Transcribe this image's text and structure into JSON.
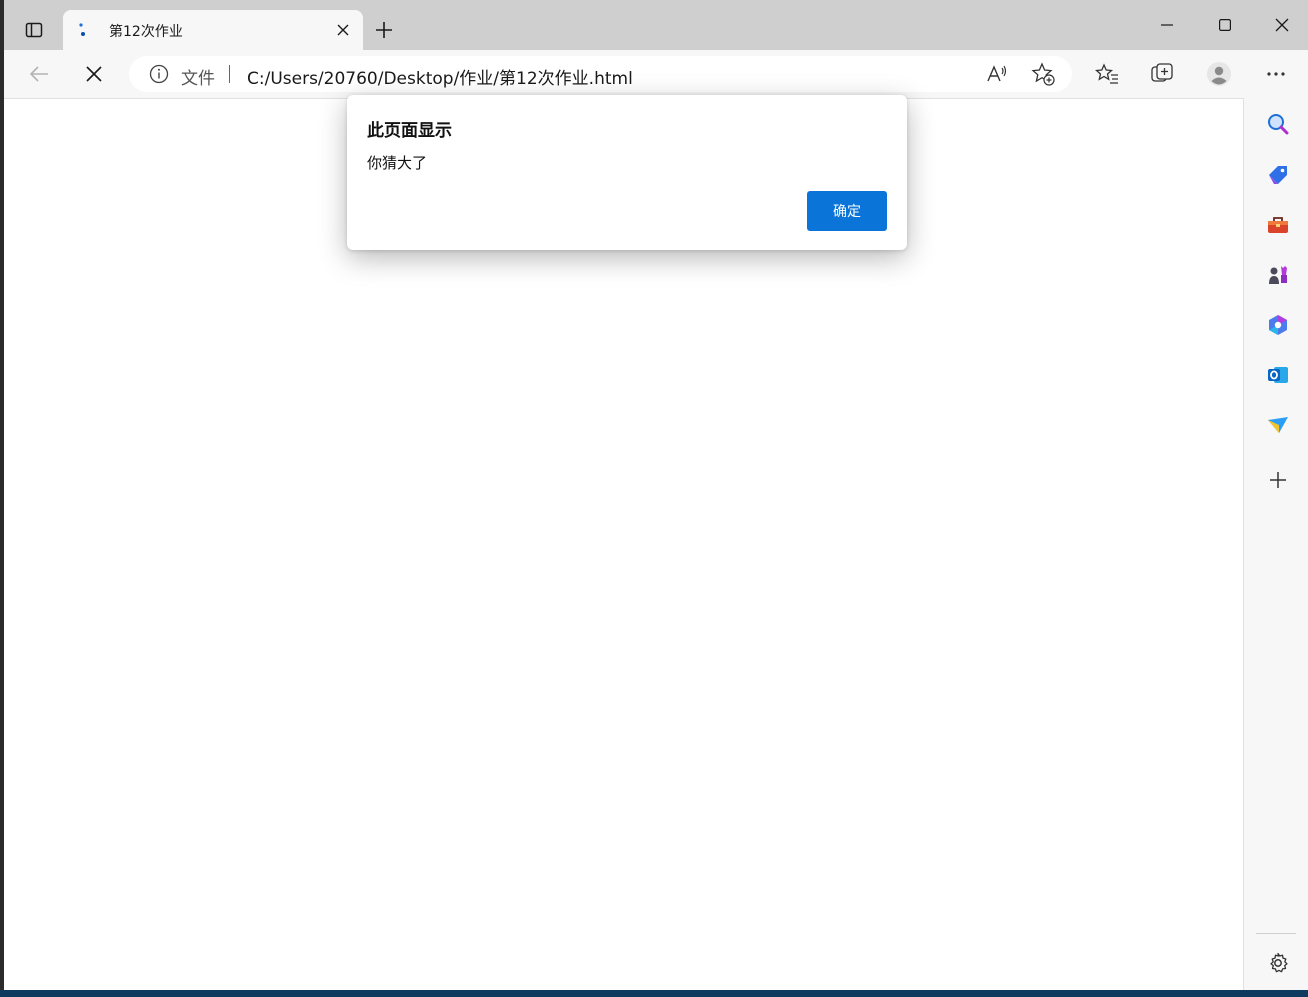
{
  "browser": {
    "tab": {
      "title": "第12次作业"
    },
    "address": {
      "label": "文件",
      "url": "C:/Users/20760/Desktop/作业/第12次作业.html"
    }
  },
  "dialog": {
    "title": "此页面显示",
    "message": "你猜大了",
    "ok_label": "确定"
  },
  "colors": {
    "accent": "#0a74d9",
    "chrome": "#cfcfcf",
    "toolbar": "#f7f7f7"
  },
  "sidebar_icons": [
    "search-icon",
    "tag-icon",
    "toolbox-icon",
    "chess-icon",
    "office-icon",
    "outlook-icon",
    "send-icon",
    "add-icon"
  ]
}
